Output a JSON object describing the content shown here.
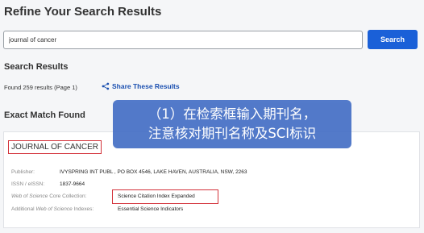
{
  "refine": {
    "title": "Refine Your Search Results",
    "search_value": "journal of cancer",
    "search_button": "Search"
  },
  "results": {
    "heading": "Search Results",
    "count_text": "Found 259 results (Page 1)",
    "share_label": "Share These Results"
  },
  "exact_match": {
    "heading": "Exact Match Found",
    "journal_title": "JOURNAL OF CANCER",
    "publisher_label": "Publisher:",
    "publisher_value": "IVYSPRING INT PUBL , PO BOX 4546, LAKE HAVEN, AUSTRALIA, NSW, 2263",
    "issn_label": "ISSN / eISSN:",
    "issn_value": "1837-9664",
    "wos_label_italic": "Web of Science",
    "wos_label_rest": " Core Collection:",
    "wos_value": "Science Citation Index Expanded",
    "additional_label_prefix": "Additional ",
    "additional_label_italic": "Web of Science",
    "additional_label_rest": " Indexes:",
    "additional_value": "Essential Science Indicators"
  },
  "annotation": {
    "line1": "（1）在检索框输入期刊名，",
    "line2": "注意核对期刊名称及SCI标识"
  },
  "colors": {
    "accent": "#1a60d8",
    "highlight": "#d3323a",
    "annotation_bg": "#4a73c7"
  }
}
